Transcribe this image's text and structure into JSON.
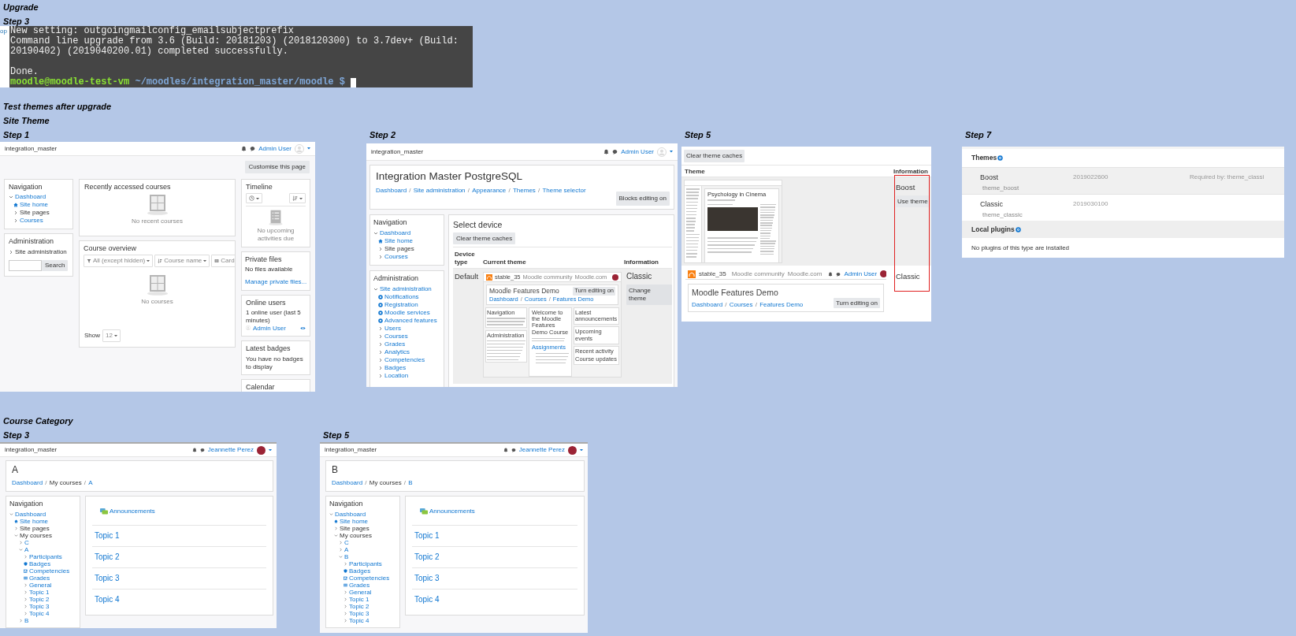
{
  "upgrade": {
    "heading": "Upgrade",
    "step": "Step 3",
    "background_fragment": "op",
    "terminal": {
      "lines": [
        {
          "kind": "output",
          "text": "New setting: outgoingmailconfig_emailsubjectprefix"
        },
        {
          "kind": "output",
          "text": "Command line upgrade from 3.6 (Build: 20181203) (2018120300) to 3.7dev+ (Build:"
        },
        {
          "kind": "output",
          "text": "20190402) (2019040200.01) completed successfully."
        },
        {
          "kind": "blank"
        },
        {
          "kind": "output",
          "text": "Done."
        }
      ],
      "prompt": {
        "user": "moodle@moodle-test-vm",
        "path": "~/moodles/integration_master/moodle $"
      }
    }
  },
  "site_theme": {
    "heading": "Test themes after upgrade",
    "subheading": "Site Theme",
    "step1": {
      "label": "Step 1",
      "navbar": {
        "site": "integration_master",
        "user": "Admin User",
        "avatar": {
          "kind": "silhouette"
        }
      },
      "customise_button": "Customise this page",
      "navigation": {
        "title": "Navigation",
        "items": [
          {
            "label": "Dashboard",
            "kind": "branch",
            "expanded": true,
            "link": true,
            "children": [
              {
                "label": "Site home",
                "kind": "home",
                "link": true
              },
              {
                "label": "Site pages",
                "kind": "branch",
                "expanded": false,
                "link": false
              },
              {
                "label": "Courses",
                "kind": "branch",
                "expanded": false,
                "link": true
              }
            ]
          }
        ]
      },
      "administration": {
        "title": "Administration",
        "items": [
          {
            "label": "Site administration",
            "kind": "branch",
            "expanded": false,
            "link": false
          }
        ],
        "search_button": "Search"
      },
      "recent": {
        "title": "Recently accessed courses",
        "empty": "No recent courses"
      },
      "overview": {
        "title": "Course overview",
        "filters": [
          {
            "label": "All (except hidden)",
            "kind": "filter"
          },
          {
            "label": "Course name",
            "kind": "sort"
          },
          {
            "label": "Card",
            "kind": "grid"
          }
        ],
        "empty": "No courses",
        "show_label": "Show",
        "page_size": "12"
      },
      "timeline": {
        "title": "Timeline",
        "empty": "No upcoming activities due"
      },
      "private_files": {
        "title": "Private files",
        "text": "No files available",
        "link": "Manage private files..."
      },
      "online_users": {
        "title": "Online users",
        "summary": "1 online user (last 5 minutes)",
        "users": [
          "Admin User"
        ]
      },
      "badges": {
        "title": "Latest badges",
        "text": "You have no badges to display"
      },
      "calendar": {
        "title": "Calendar"
      }
    },
    "step2": {
      "label": "Step 2",
      "navbar": {
        "site": "integration_master",
        "user": "Admin User",
        "avatar": {
          "kind": "silhouette"
        }
      },
      "header": {
        "title": "Integration Master PostgreSQL",
        "breadcrumb": {
          "separator": "/",
          "items": [
            {
              "text": "Dashboard",
              "link": true
            },
            {
              "text": "Site administration",
              "link": true
            },
            {
              "text": "Appearance",
              "link": true
            },
            {
              "text": "Themes",
              "link": true
            },
            {
              "text": "Theme selector",
              "link": true
            }
          ]
        },
        "button": "Blocks editing on"
      },
      "navigation": {
        "title": "Navigation",
        "items": [
          {
            "label": "Dashboard",
            "kind": "branch",
            "expanded": true,
            "link": true,
            "children": [
              {
                "label": "Site home",
                "kind": "home",
                "link": true
              },
              {
                "label": "Site pages",
                "kind": "branch",
                "expanded": false,
                "link": false
              },
              {
                "label": "Courses",
                "kind": "branch",
                "expanded": false,
                "link": true
              }
            ]
          }
        ]
      },
      "administration": {
        "title": "Administration",
        "items": [
          {
            "label": "Site administration",
            "kind": "branch",
            "expanded": true,
            "link": true,
            "children": [
              {
                "label": "Notifications",
                "kind": "setting",
                "link": true
              },
              {
                "label": "Registration",
                "kind": "setting",
                "link": true
              },
              {
                "label": "Moodle services",
                "kind": "setting",
                "link": true
              },
              {
                "label": "Advanced features",
                "kind": "setting",
                "link": true
              },
              {
                "label": "Users",
                "kind": "branch",
                "expanded": false,
                "link": true
              },
              {
                "label": "Courses",
                "kind": "branch",
                "expanded": false,
                "link": true
              },
              {
                "label": "Grades",
                "kind": "branch",
                "expanded": false,
                "link": true
              },
              {
                "label": "Analytics",
                "kind": "branch",
                "expanded": false,
                "link": true
              },
              {
                "label": "Competencies",
                "kind": "branch",
                "expanded": false,
                "link": true
              },
              {
                "label": "Badges",
                "kind": "branch",
                "expanded": false,
                "link": true
              },
              {
                "label": "Location",
                "kind": "branch",
                "expanded": false,
                "link": true
              }
            ]
          }
        ]
      },
      "main": {
        "title": "Select device",
        "clear_button": "Clear theme caches",
        "columns": [
          "Device type",
          "Current theme",
          "Information"
        ],
        "rows": [
          {
            "device": "Default",
            "theme": "Classic",
            "button": "Change theme",
            "preview": {
              "kind": "full",
              "logo": "stable_35",
              "menu": [
                "Moodle community",
                "Moodle.com"
              ],
              "title": "Moodle Features Demo",
              "breadcrumb": {
                "separator": "/",
                "items": [
                  {
                    "text": "Dashboard",
                    "link": true
                  },
                  {
                    "text": "Courses",
                    "link": true
                  },
                  {
                    "text": "Features Demo",
                    "link": true
                  }
                ]
              },
              "button": "Turn editing on",
              "blocks": [
                "Navigation",
                "Administration"
              ],
              "welcome": "Welcome to the Moodle Features Demo Course",
              "section": "Assignments",
              "side_blocks": [
                "Latest announcements",
                "Upcoming events",
                "Recent activity"
              ],
              "footer": "Course updates"
            }
          }
        ]
      }
    },
    "step5": {
      "label": "Step 5",
      "clear_button": "Clear theme caches",
      "columns": [
        "Theme",
        "Information"
      ],
      "information_highlighted": true,
      "rows": [
        {
          "kind": "boost",
          "theme": "Boost",
          "button": "Use theme",
          "preview": {
            "kind": "boost",
            "course": "Psychology in Cinema"
          }
        },
        {
          "kind": "classic",
          "theme": "Classic",
          "preview": {
            "kind": "header",
            "logo": "stable_35",
            "menu": [
              "Moodle community",
              "Moodle.com"
            ],
            "user": "Admin User",
            "title": "Moodle Features Demo",
            "breadcrumb": {
              "separator": "/",
              "items": [
                {
                  "text": "Dashboard",
                  "link": true
                },
                {
                  "text": "Courses",
                  "link": true
                },
                {
                  "text": "Features Demo",
                  "link": true
                }
              ]
            },
            "button": "Turn editing on"
          }
        }
      ]
    },
    "step7": {
      "label": "Step 7",
      "sections": [
        {
          "title": "Themes",
          "plugins": [
            {
              "name": "Boost",
              "component": "theme_boost",
              "version": "2019022600",
              "note": "Required by: theme_classi"
            },
            {
              "name": "Classic",
              "component": "theme_classic",
              "version": "2019030100"
            }
          ]
        },
        {
          "title": "Local plugins",
          "empty": "No plugins of this type are installed"
        }
      ]
    }
  },
  "course_category": {
    "heading": "Course Category",
    "steps": [
      {
        "label": "Step 3",
        "navbar": {
          "site": "integration_master",
          "user": "Jeannette Perez",
          "avatar": {
            "kind": "photo"
          }
        },
        "course": "A",
        "breadcrumb": {
          "separator": "/",
          "items": [
            {
              "text": "Dashboard",
              "link": true
            },
            {
              "text": "My courses",
              "link": false
            },
            {
              "text": "A",
              "link": true
            }
          ]
        },
        "navigation": {
          "title": "Navigation",
          "items": [
            {
              "label": "Dashboard",
              "kind": "branch",
              "expanded": true,
              "link": true,
              "children": [
                {
                  "label": "Site home",
                  "kind": "home",
                  "link": true
                },
                {
                  "label": "Site pages",
                  "kind": "branch",
                  "expanded": false,
                  "link": false
                },
                {
                  "label": "My courses",
                  "kind": "branch",
                  "expanded": true,
                  "link": false,
                  "children": [
                    {
                      "label": "C",
                      "kind": "branch",
                      "expanded": false,
                      "link": true
                    },
                    {
                      "label": "A",
                      "kind": "branch",
                      "expanded": true,
                      "link": true,
                      "children": [
                        {
                          "label": "Participants",
                          "kind": "branch",
                          "expanded": false,
                          "link": true
                        },
                        {
                          "label": "Badges",
                          "kind": "badge",
                          "link": true
                        },
                        {
                          "label": "Competencies",
                          "kind": "competency",
                          "link": true
                        },
                        {
                          "label": "Grades",
                          "kind": "grades",
                          "link": true
                        },
                        {
                          "label": "General",
                          "kind": "branch",
                          "expanded": false,
                          "link": true
                        },
                        {
                          "label": "Topic 1",
                          "kind": "branch",
                          "expanded": false,
                          "link": true
                        },
                        {
                          "label": "Topic 2",
                          "kind": "branch",
                          "expanded": false,
                          "link": true
                        },
                        {
                          "label": "Topic 3",
                          "kind": "branch",
                          "expanded": false,
                          "link": true
                        },
                        {
                          "label": "Topic 4",
                          "kind": "branch",
                          "expanded": false,
                          "link": true
                        }
                      ]
                    },
                    {
                      "label": "B",
                      "kind": "branch",
                      "expanded": false,
                      "link": true
                    }
                  ]
                }
              ]
            }
          ]
        },
        "activity": "Announcements",
        "topics": [
          "Topic 1",
          "Topic 2",
          "Topic 3",
          "Topic 4"
        ]
      },
      {
        "label": "Step 5",
        "navbar": {
          "site": "integration_master",
          "user": "Jeannette Perez",
          "avatar": {
            "kind": "photo"
          }
        },
        "course": "B",
        "breadcrumb": {
          "separator": "/",
          "items": [
            {
              "text": "Dashboard",
              "link": true
            },
            {
              "text": "My courses",
              "link": false
            },
            {
              "text": "B",
              "link": true
            }
          ]
        },
        "navigation": {
          "title": "Navigation",
          "items": [
            {
              "label": "Dashboard",
              "kind": "branch",
              "expanded": true,
              "link": true,
              "children": [
                {
                  "label": "Site home",
                  "kind": "home",
                  "link": true
                },
                {
                  "label": "Site pages",
                  "kind": "branch",
                  "expanded": false,
                  "link": false
                },
                {
                  "label": "My courses",
                  "kind": "branch",
                  "expanded": true,
                  "link": false,
                  "children": [
                    {
                      "label": "C",
                      "kind": "branch",
                      "expanded": false,
                      "link": true
                    },
                    {
                      "label": "A",
                      "kind": "branch",
                      "expanded": false,
                      "link": true
                    },
                    {
                      "label": "B",
                      "kind": "branch",
                      "expanded": true,
                      "link": true,
                      "children": [
                        {
                          "label": "Participants",
                          "kind": "branch",
                          "expanded": false,
                          "link": true
                        },
                        {
                          "label": "Badges",
                          "kind": "badge",
                          "link": true
                        },
                        {
                          "label": "Competencies",
                          "kind": "competency",
                          "link": true
                        },
                        {
                          "label": "Grades",
                          "kind": "grades",
                          "link": true
                        },
                        {
                          "label": "General",
                          "kind": "branch",
                          "expanded": false,
                          "link": true
                        },
                        {
                          "label": "Topic 1",
                          "kind": "branch",
                          "expanded": false,
                          "link": true
                        },
                        {
                          "label": "Topic 2",
                          "kind": "branch",
                          "expanded": false,
                          "link": true
                        },
                        {
                          "label": "Topic 3",
                          "kind": "branch",
                          "expanded": false,
                          "link": true
                        },
                        {
                          "label": "Topic 4",
                          "kind": "branch",
                          "expanded": false,
                          "link": true
                        }
                      ]
                    }
                  ]
                }
              ]
            }
          ]
        },
        "activity": "Announcements",
        "topics": [
          "Topic 1",
          "Topic 2",
          "Topic 3",
          "Topic 4"
        ]
      }
    ]
  }
}
